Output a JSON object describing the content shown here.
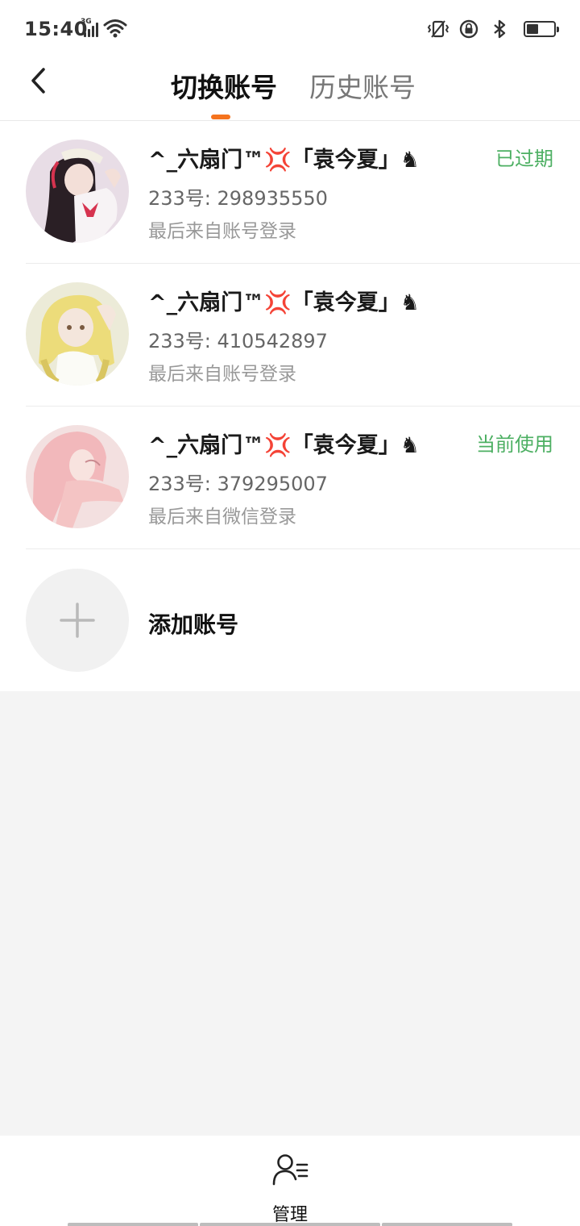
{
  "status_bar": {
    "time": "15:40",
    "network": "3G",
    "icons": [
      "signal-icon",
      "wifi-icon",
      "vibrate-icon",
      "rotation-lock-icon",
      "bluetooth-icon",
      "battery-icon"
    ],
    "battery_level": 0.4
  },
  "header": {
    "tabs": [
      {
        "label": "切换账号",
        "active": true
      },
      {
        "label": "历史账号",
        "active": false
      }
    ],
    "accent_color": "#f5731e"
  },
  "accounts": [
    {
      "name": "^_六扇门™💢「袁今夏」♞",
      "id_line": "233号: 298935550",
      "source": "最后来自账号登录",
      "status": "已过期"
    },
    {
      "name": "^_六扇门™💢「袁今夏」♞",
      "id_line": "233号: 410542897",
      "source": "最后来自账号登录",
      "status": ""
    },
    {
      "name": "^_六扇门™💢「袁今夏」♞",
      "id_line": "233号: 379295007",
      "source": "最后来自微信登录",
      "status": "当前使用"
    }
  ],
  "add_account": {
    "label": "添加账号"
  },
  "bottom_bar": {
    "manage_label": "管理"
  },
  "colors": {
    "status_green": "#4caf62",
    "background": "#f4f4f4"
  }
}
